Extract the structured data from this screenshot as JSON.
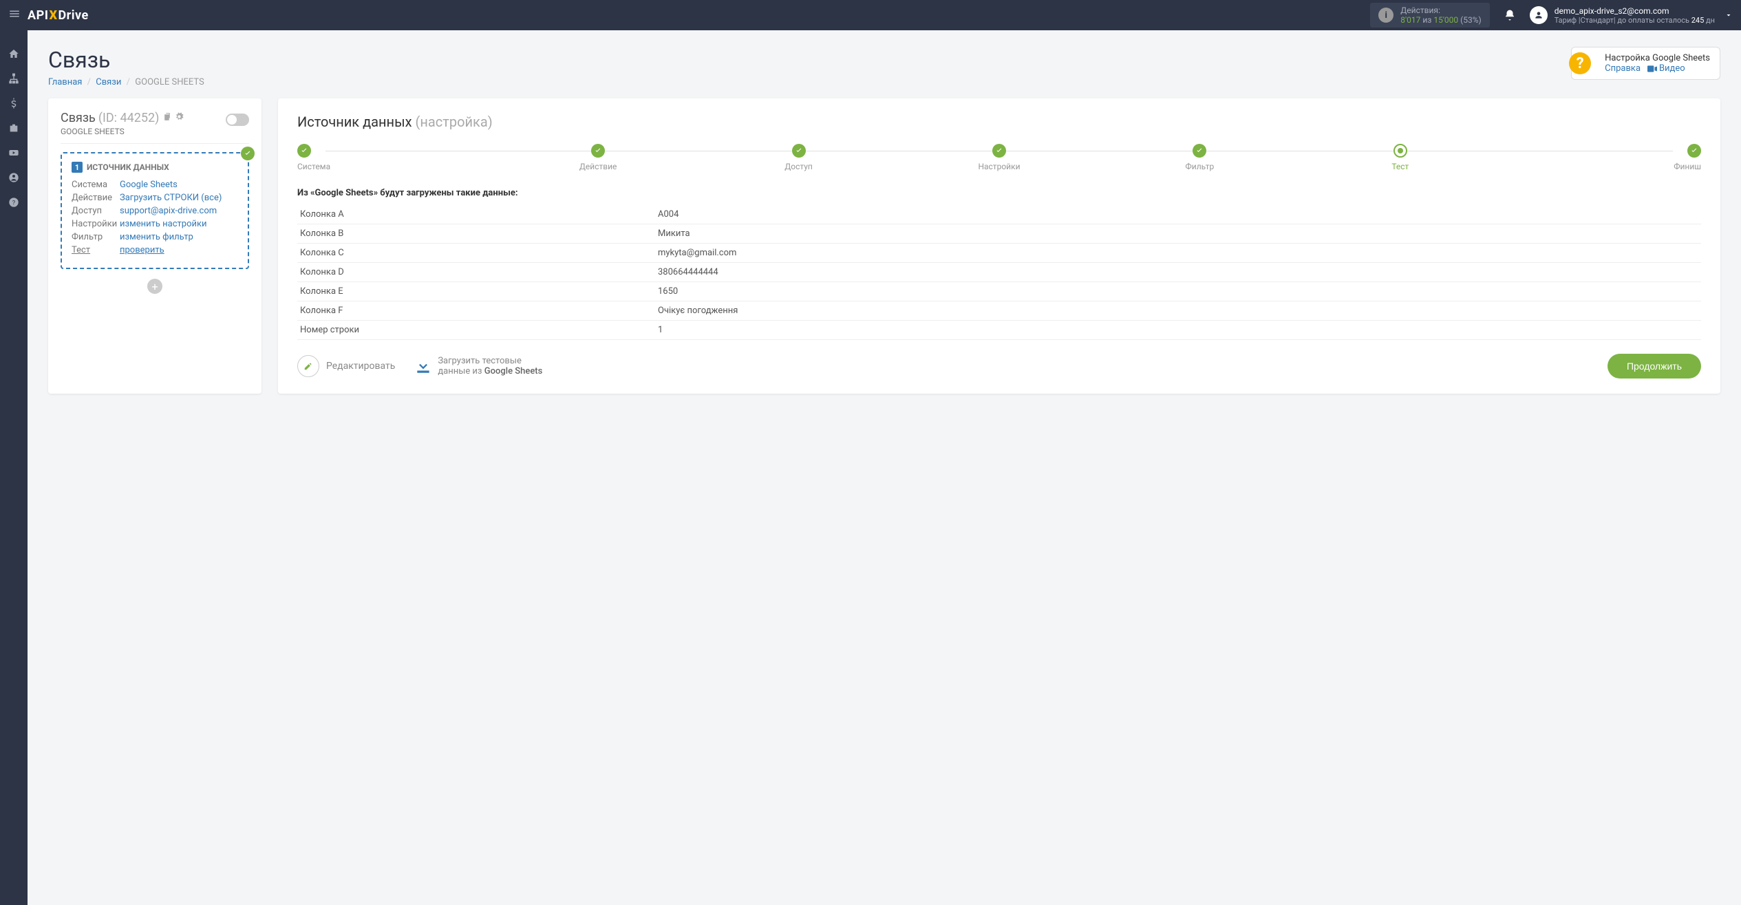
{
  "header": {
    "logo": {
      "pre": "API",
      "x": "X",
      "post": "Drive"
    },
    "actions": {
      "label": "Действия:",
      "used": "8'017",
      "of": "из",
      "total": "15'000",
      "pct": "(53%)"
    },
    "user": {
      "email": "demo_apix-drive_s2@com.com",
      "tariff_pre": "Тариф |Стандарт| до оплаты осталось",
      "days": "245",
      "tariff_post": "дн"
    }
  },
  "page": {
    "title": "Связь",
    "breadcrumb": {
      "home": "Главная",
      "links": "Связи",
      "current": "GOOGLE SHEETS"
    }
  },
  "help": {
    "title": "Настройка Google Sheets",
    "help_link": "Справка",
    "video_link": "Видео"
  },
  "left": {
    "title": "Связь",
    "id": "(ID: 44252)",
    "sub": "GOOGLE SHEETS",
    "src_num": "1",
    "src_title": "ИСТОЧНИК ДАННЫХ",
    "rows": [
      {
        "label": "Система",
        "value": "Google Sheets",
        "link": true
      },
      {
        "label": "Действие",
        "value": "Загрузить СТРОКИ (все)",
        "link": true
      },
      {
        "label": "Доступ",
        "value": "support@apix-drive.com",
        "link": true
      },
      {
        "label": "Настройки",
        "value": "изменить настройки",
        "link": true
      },
      {
        "label": "Фильтр",
        "value": "изменить фильтр",
        "link": true
      },
      {
        "label": "Тест",
        "value": "проверить",
        "und": true
      }
    ]
  },
  "right": {
    "title": "Источник данных",
    "subtitle": "(настройка)",
    "steps": [
      {
        "label": "Система",
        "state": "done"
      },
      {
        "label": "Действие",
        "state": "done"
      },
      {
        "label": "Доступ",
        "state": "done"
      },
      {
        "label": "Настройки",
        "state": "done"
      },
      {
        "label": "Фильтр",
        "state": "done"
      },
      {
        "label": "Тест",
        "state": "active"
      },
      {
        "label": "Финиш",
        "state": "done"
      }
    ],
    "data_title": "Из «Google Sheets» будут загружены такие данные:",
    "rows": [
      {
        "k": "Колонка A",
        "v": "A004"
      },
      {
        "k": "Колонка B",
        "v": "Микита"
      },
      {
        "k": "Колонка C",
        "v": "mykyta@gmail.com"
      },
      {
        "k": "Колонка D",
        "v": "380664444444"
      },
      {
        "k": "Колонка E",
        "v": "1650"
      },
      {
        "k": "Колонка F",
        "v": "Очікує погодження"
      },
      {
        "k": "Номер строки",
        "v": "1"
      }
    ],
    "edit_label": "Редактировать",
    "load_label1": "Загрузить тестовые",
    "load_label2": "данные из",
    "load_strong": "Google Sheets",
    "continue": "Продолжить"
  }
}
